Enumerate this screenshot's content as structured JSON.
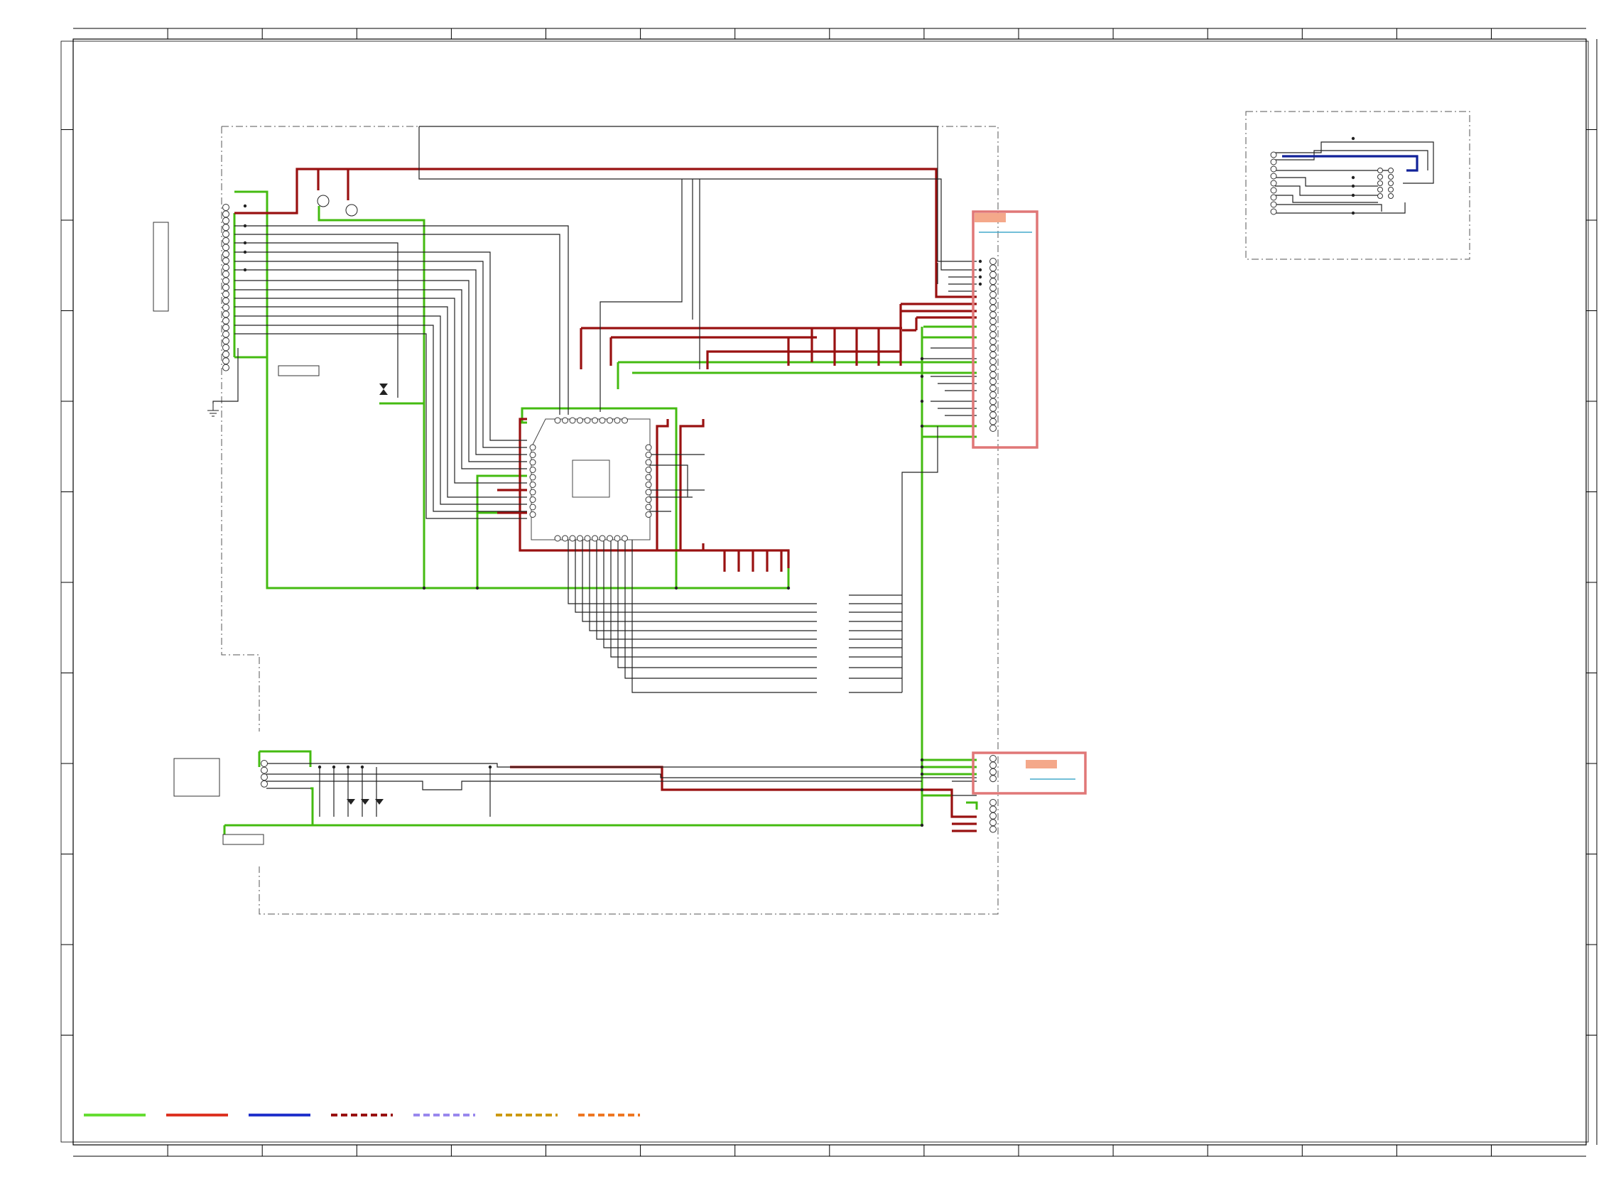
{
  "document": {
    "type": "schematic-wiring-diagram",
    "visible_text": []
  },
  "legend": {
    "entries": [
      {
        "style": "solid",
        "color": "#66dd33"
      },
      {
        "style": "solid",
        "color": "#dd3322"
      },
      {
        "style": "solid",
        "color": "#2233cc"
      },
      {
        "style": "dashed",
        "color": "#991111"
      },
      {
        "style": "dashed",
        "color": "#9988ee"
      },
      {
        "style": "dashed",
        "color": "#cc9911"
      },
      {
        "style": "dashed",
        "color": "#ee7722"
      }
    ]
  },
  "colors": {
    "ground_wire": "#44bb11",
    "power_wire": "#991111",
    "signal_wire": "#222222",
    "data_wire": "#112299",
    "highlight_box": "#e07777",
    "highlight_tag": "#f4a88a",
    "cyan_mark": "#44aacc",
    "border": "#000000"
  }
}
